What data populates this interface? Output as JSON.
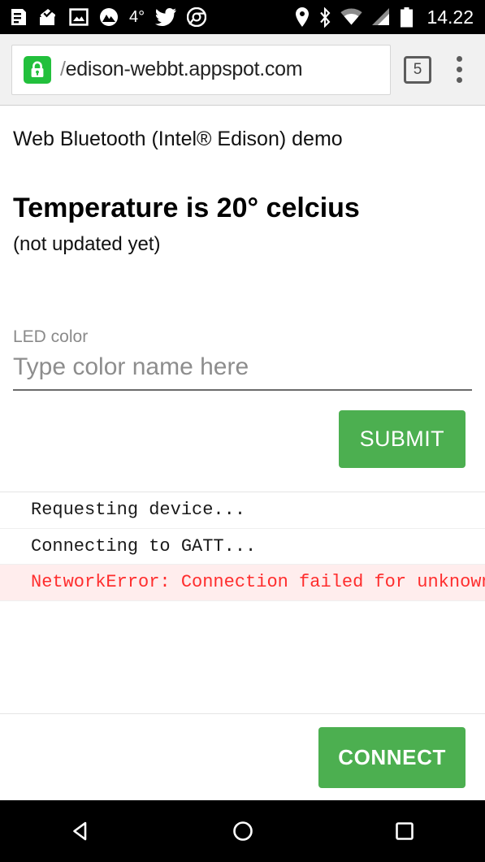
{
  "status_bar": {
    "time": "14.22",
    "weather_temp": "4°",
    "left_icons": [
      "news-icon",
      "mail-icon",
      "photo-icon",
      "mountain-app-icon",
      "weather-temp",
      "twitter-icon",
      "chrome-icon"
    ],
    "right_icons": [
      "location-pin-icon",
      "bluetooth-icon",
      "wifi-icon",
      "cellular-signal-icon",
      "battery-icon"
    ]
  },
  "browser": {
    "url": "edison-webbt.appspot.com",
    "url_clipped_prefix": "/",
    "security_icon": "lock-icon",
    "tab_count": "5",
    "overflow_menu": "three-dot-menu-icon"
  },
  "page": {
    "demo_title": "Web Bluetooth (Intel® Edison) demo",
    "temperature_heading": "Temperature is 20° celcius",
    "temperature_note": "(not updated yet)",
    "field": {
      "label": "LED color",
      "placeholder": "Type color name here",
      "value": ""
    },
    "submit_label": "SUBMIT",
    "connect_label": "CONNECT",
    "log": [
      {
        "text": "Requesting device...",
        "type": "info"
      },
      {
        "text": "Connecting to GATT...",
        "type": "info"
      },
      {
        "text": "NetworkError: Connection failed for unknown",
        "type": "error"
      }
    ]
  },
  "nav_bar": {
    "back": "back-triangle-icon",
    "home": "home-circle-icon",
    "recents": "recents-square-icon"
  },
  "colors": {
    "accent_green": "#4caf50",
    "lock_green": "#22c03c",
    "error_red": "#ff2d2d",
    "error_bg": "#ffeded"
  }
}
